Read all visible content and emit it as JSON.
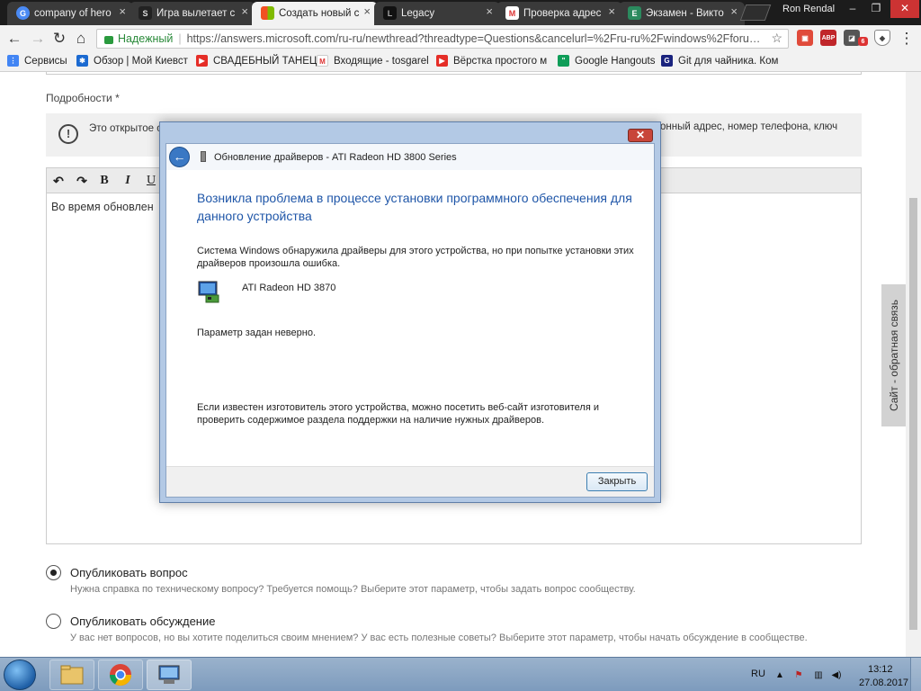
{
  "browser": {
    "tabs": [
      {
        "label": "company of hero",
        "icon": "chrome-icon"
      },
      {
        "label": "Игра вылетает с",
        "icon": "steam-icon"
      },
      {
        "label": "Создать новый с",
        "icon": "microsoft-icon"
      },
      {
        "label": "Legacy",
        "icon": "legacy-icon"
      },
      {
        "label": "Проверка адрес",
        "icon": "gmail-icon"
      },
      {
        "label": "Экзамен - Викто",
        "icon": "app-icon"
      }
    ],
    "profile_name": "Ron Rendal",
    "secure_label": "Надежный",
    "url": "https://answers.microsoft.com/ru-ru/newthread?threadtype=Questions&cancelurl=%2Fru-ru%2Fwindows%2Fforu…",
    "bookmarks": [
      {
        "label": "Сервисы",
        "icon": "apps-icon"
      },
      {
        "label": "Обзор | Мой Киевст",
        "icon": "kyivstar-icon"
      },
      {
        "label": "СВАДЕБНЫЙ ТАНЕЦ",
        "icon": "youtube-icon"
      },
      {
        "label": "Входящие - tosgarel",
        "icon": "gmail-icon"
      },
      {
        "label": "Вёрстка простого м",
        "icon": "youtube-icon"
      },
      {
        "label": "Google Hangouts",
        "icon": "hangouts-icon"
      },
      {
        "label": "Git для чайника. Ком",
        "icon": "git-icon"
      }
    ],
    "extensions": [
      "ext-red-icon",
      "adblock-icon",
      "ext-gray-icon",
      "ext-badge-icon",
      "shield-icon"
    ],
    "extension_badge": "6"
  },
  "page": {
    "details_label": "Подробности *",
    "notice_left": "Это открытое с… продукта, паро…",
    "notice_right": "онный адрес, номер телефона, ключ",
    "editor_text": "Во время обновлен",
    "option1": {
      "label": "Опубликовать вопрос",
      "hint": "Нужна справка по техническому вопросу? Требуется помощь? Выберите этот параметр, чтобы задать вопрос сообществу."
    },
    "option2": {
      "label": "Опубликовать обсуждение",
      "hint": "У вас нет вопросов, но вы хотите поделиться своим мнением? У вас есть полезные советы? Выберите этот параметр, чтобы начать обсуждение в сообществе."
    },
    "feedback": "Сайт - обратная связь"
  },
  "dialog": {
    "title": "Обновление драйверов - ATI Radeon HD 3800 Series",
    "heading": "Возникла проблема в процессе установки программного обеспечения для данного устройства",
    "p1": "Система Windows обнаружила драйверы для этого устройства, но при попытке установки этих драйверов произошла ошибка.",
    "device": "ATI Radeon HD 3870",
    "p2": "Параметр задан неверно.",
    "p3": "Если известен изготовитель этого устройства, можно посетить веб-сайт изготовителя и проверить содержимое раздела поддержки на наличие нужных драйверов.",
    "close_button": "Закрыть"
  },
  "taskbar": {
    "lang": "RU",
    "time": "13:12",
    "date": "27.08.2017"
  }
}
